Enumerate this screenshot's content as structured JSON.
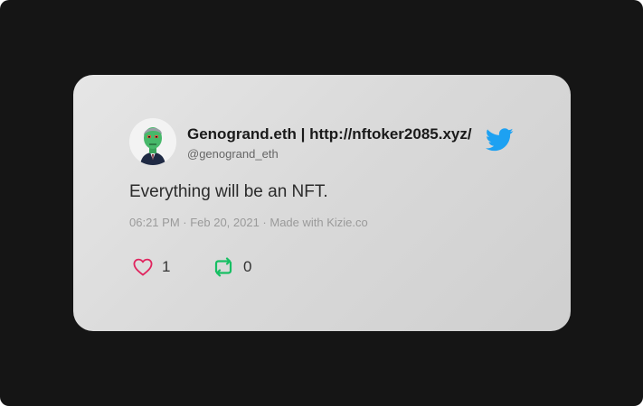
{
  "tweet": {
    "author_name": "Genogrand.eth | http://nftoker2085.xyz/",
    "handle": "@genogrand_eth",
    "text": "Everything will be an NFT.",
    "meta": "06:21 PM · Feb 20, 2021 · Made with Kizie.co",
    "likes": "1",
    "retweets": "0"
  },
  "icons": {
    "brand": "twitter-icon",
    "like": "heart-icon",
    "retweet": "retweet-icon"
  },
  "colors": {
    "background": "#151515",
    "card": "#dcdcdc",
    "twitter_blue": "#1da1f2",
    "like_red": "#e0245e",
    "retweet_green": "#17bf63"
  }
}
